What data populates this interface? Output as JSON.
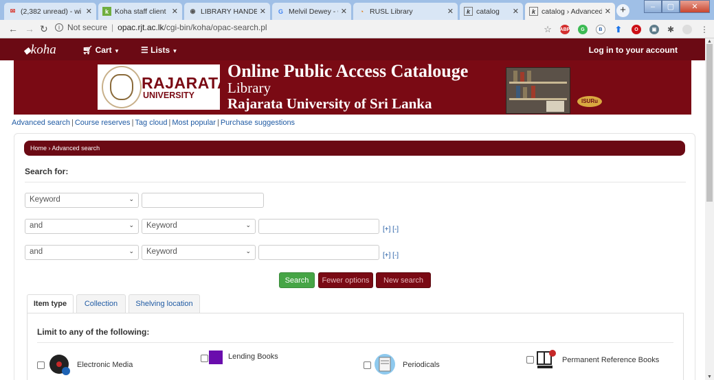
{
  "browser": {
    "tabs": [
      {
        "title": "(2,382 unread) - wi",
        "favicon": "mail-icon"
      },
      {
        "title": "Koha staff client",
        "favicon": "koha-icon"
      },
      {
        "title": "LIBRARY HANDBOO",
        "favicon": "globe-icon"
      },
      {
        "title": "Melvil Dewey - Goo",
        "favicon": "google-icon"
      },
      {
        "title": "RUSL Library",
        "favicon": "rusl-icon"
      },
      {
        "title": "catalog",
        "favicon": "koha-icon"
      },
      {
        "title": "catalog › Advanced",
        "favicon": "koha-icon"
      }
    ],
    "new_tab": "+",
    "address": {
      "security": "Not secure",
      "host": "opac.rjt.ac.lk",
      "path": "/cgi-bin/koha/opac-search.pl"
    }
  },
  "koha_bar": {
    "logo": "koha",
    "cart": "Cart",
    "lists": "Lists",
    "login": "Log in to your account"
  },
  "banner": {
    "university_name": "RAJARATA",
    "university_sub": "UNIVERSITY",
    "title": "Online Public Access Catalouge",
    "library": "Library",
    "university_full": "Rajarata University of Sri Lanka",
    "badge": "ISURu"
  },
  "quick_links": [
    "Advanced search",
    "Course reserves",
    "Tag cloud",
    "Most popular",
    "Purchase suggestions"
  ],
  "breadcrumb": {
    "home": "Home",
    "separator": "›",
    "current": "Advanced search"
  },
  "search": {
    "heading": "Search for:",
    "rows": [
      {
        "operator": "",
        "index": "Keyword",
        "value": ""
      },
      {
        "operator": "and",
        "index": "Keyword",
        "value": "",
        "add_remove": "[+] [-]"
      },
      {
        "operator": "and",
        "index": "Keyword",
        "value": "",
        "add_remove": "[+] [-]"
      }
    ],
    "buttons": {
      "search": "Search",
      "fewer": "Fewer options",
      "new": "New search"
    }
  },
  "limit_tabs": [
    "Item type",
    "Collection",
    "Shelving location"
  ],
  "limit_heading": "Limit to any of the following:",
  "item_types": [
    "Electronic Media",
    "Lending Books",
    "Periodicals",
    "Permanent Reference Books"
  ],
  "colors": {
    "brand": "#6b0a14",
    "link": "#1f5aa3",
    "search_button": "#46a546"
  }
}
